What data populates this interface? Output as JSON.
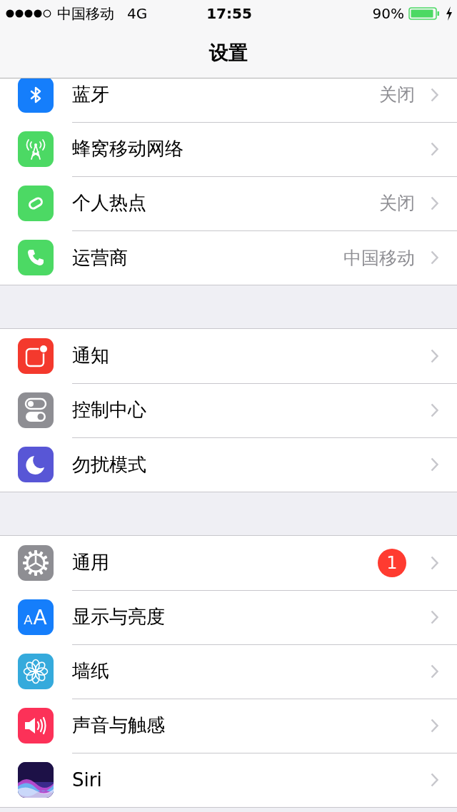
{
  "status_bar": {
    "carrier": "中国移动",
    "network": "4G",
    "time": "17:55",
    "battery": "90%"
  },
  "nav_bar": {
    "title": "设置"
  },
  "sections": [
    {
      "items": [
        {
          "kind": "bluetooth",
          "label": "蓝牙",
          "value": "关闭"
        },
        {
          "kind": "cellular",
          "label": "蜂窝移动网络"
        },
        {
          "kind": "hotspot",
          "label": "个人热点",
          "value": "关闭"
        },
        {
          "kind": "carrier",
          "label": "运营商",
          "value": "中国移动"
        }
      ]
    },
    {
      "items": [
        {
          "kind": "notifications",
          "label": "通知"
        },
        {
          "kind": "control",
          "label": "控制中心"
        },
        {
          "kind": "dnd",
          "label": "勿扰模式"
        }
      ]
    },
    {
      "items": [
        {
          "kind": "general",
          "label": "通用",
          "badge": "1"
        },
        {
          "kind": "display",
          "label": "显示与亮度",
          "icon_text": "AA"
        },
        {
          "kind": "wallpaper",
          "label": "墙纸"
        },
        {
          "kind": "sounds",
          "label": "声音与触感"
        },
        {
          "kind": "siri",
          "label": "Siri"
        }
      ]
    }
  ]
}
